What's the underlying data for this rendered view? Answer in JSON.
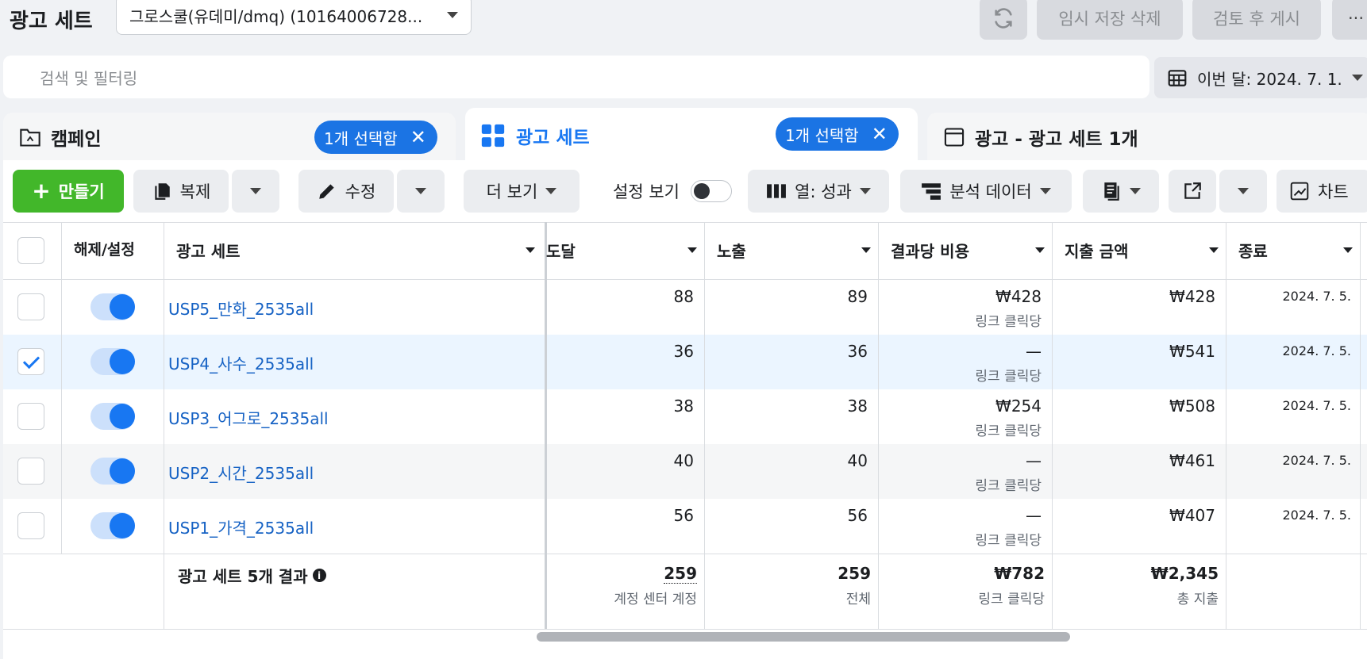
{
  "header": {
    "title": "광고 세트",
    "account": "그로스쿨(유데미/dmq) (10164006728...",
    "discard_draft": "임시 저장 삭제",
    "review_publish": "검토 후 게시",
    "more": "···"
  },
  "search": {
    "placeholder": "검색 및 필터링"
  },
  "date_range": "이번 달: 2024. 7. 1.",
  "tabs": [
    {
      "label": "캠페인",
      "selected": "1개 선택함"
    },
    {
      "label": "광고 세트",
      "selected": "1개 선택함"
    },
    {
      "label": "광고 - 광고 세트 1개"
    }
  ],
  "toolbar": {
    "create": "만들기",
    "duplicate": "복제",
    "edit": "수정",
    "more": "더 보기",
    "view_setup": "설정 보기",
    "columns": "열: 성과",
    "breakdown": "분석 데이터",
    "charts": "차트"
  },
  "table": {
    "headers": {
      "toggle": "해제/설정",
      "name": "광고 세트",
      "reach": "도달",
      "impressions": "노출",
      "cost_per_result": "결과당 비용",
      "amount_spent": "지출 금액",
      "end": "종료"
    },
    "rows": [
      {
        "name": "USP5_만화_2535all",
        "reach": "88",
        "impressions": "89",
        "cpr": "₩428",
        "cpr_sub": "링크 클릭당",
        "spent": "₩428",
        "end": "2024. 7. 5.",
        "checked": false
      },
      {
        "name": "USP4_사수_2535all",
        "reach": "36",
        "impressions": "36",
        "cpr": "—",
        "cpr_sub": "링크 클릭당",
        "spent": "₩541",
        "end": "2024. 7. 5.",
        "checked": true
      },
      {
        "name": "USP3_어그로_2535all",
        "reach": "38",
        "impressions": "38",
        "cpr": "₩254",
        "cpr_sub": "링크 클릭당",
        "spent": "₩508",
        "end": "2024. 7. 5.",
        "checked": false
      },
      {
        "name": "USP2_시간_2535all",
        "reach": "40",
        "impressions": "40",
        "cpr": "—",
        "cpr_sub": "링크 클릭당",
        "spent": "₩461",
        "end": "2024. 7. 5.",
        "checked": false
      },
      {
        "name": "USP1_가격_2535all",
        "reach": "56",
        "impressions": "56",
        "cpr": "—",
        "cpr_sub": "링크 클릭당",
        "spent": "₩407",
        "end": "2024. 7. 5.",
        "checked": false
      }
    ],
    "summary": {
      "label": "광고 세트 5개 결과",
      "reach": "259",
      "reach_sub": "계정 센터 계정",
      "impressions": "259",
      "impressions_sub": "전체",
      "cpr": "₩782",
      "cpr_sub": "링크 클릭당",
      "spent": "₩2,345",
      "spent_sub": "총 지출"
    }
  }
}
